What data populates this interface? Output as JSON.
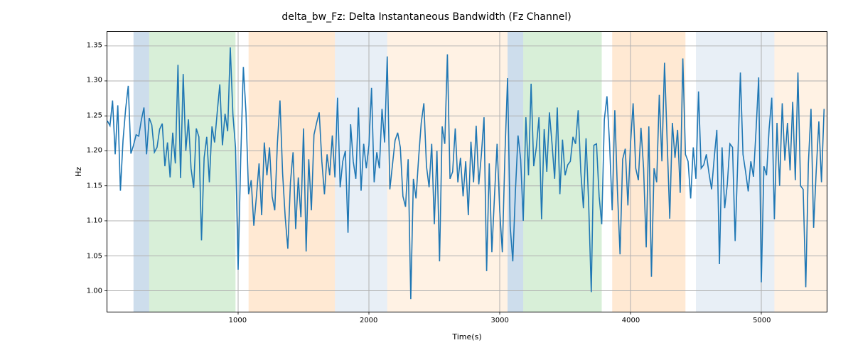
{
  "chart_data": {
    "type": "line",
    "title": "delta_bw_Fz: Delta Instantaneous Bandwidth (Fz Channel)",
    "xlabel": "Time(s)",
    "ylabel": "Hz",
    "xlim": [
      0,
      5500
    ],
    "ylim": [
      0.97,
      1.37
    ],
    "xticks": [
      1000,
      2000,
      3000,
      4000,
      5000
    ],
    "yticks": [
      1.0,
      1.05,
      1.1,
      1.15,
      1.2,
      1.25,
      1.3,
      1.35
    ],
    "grid": true,
    "regions": [
      {
        "x0": 200,
        "x1": 320,
        "class": "blue"
      },
      {
        "x0": 320,
        "x1": 980,
        "class": "green"
      },
      {
        "x0": 1080,
        "x1": 1740,
        "class": "orange"
      },
      {
        "x0": 1740,
        "x1": 2140,
        "class": "lblue"
      },
      {
        "x0": 2140,
        "x1": 3060,
        "class": "lorange"
      },
      {
        "x0": 3060,
        "x1": 3180,
        "class": "blue"
      },
      {
        "x0": 3180,
        "x1": 3780,
        "class": "green"
      },
      {
        "x0": 3860,
        "x1": 4420,
        "class": "orange"
      },
      {
        "x0": 4500,
        "x1": 5100,
        "class": "lblue"
      },
      {
        "x0": 5100,
        "x1": 5500,
        "class": "lorange"
      }
    ],
    "series": [
      {
        "name": "delta_bw_Fz",
        "color": "#1f77b4",
        "x_start": 0,
        "x_step": 20,
        "y": [
          1.243,
          1.236,
          1.272,
          1.195,
          1.265,
          1.143,
          1.215,
          1.26,
          1.293,
          1.196,
          1.208,
          1.223,
          1.221,
          1.244,
          1.262,
          1.195,
          1.247,
          1.237,
          1.198,
          1.205,
          1.231,
          1.239,
          1.178,
          1.212,
          1.162,
          1.226,
          1.182,
          1.323,
          1.161,
          1.31,
          1.2,
          1.245,
          1.175,
          1.147,
          1.232,
          1.22,
          1.072,
          1.19,
          1.22,
          1.155,
          1.235,
          1.212,
          1.255,
          1.295,
          1.208,
          1.253,
          1.228,
          1.348,
          1.252,
          1.205,
          1.03,
          1.19,
          1.32,
          1.255,
          1.138,
          1.158,
          1.093,
          1.135,
          1.182,
          1.108,
          1.212,
          1.165,
          1.205,
          1.135,
          1.115,
          1.21,
          1.272,
          1.168,
          1.105,
          1.06,
          1.155,
          1.198,
          1.088,
          1.162,
          1.105,
          1.232,
          1.056,
          1.188,
          1.115,
          1.223,
          1.24,
          1.255,
          1.185,
          1.138,
          1.195,
          1.165,
          1.222,
          1.162,
          1.276,
          1.148,
          1.185,
          1.2,
          1.083,
          1.238,
          1.185,
          1.16,
          1.262,
          1.143,
          1.21,
          1.175,
          1.208,
          1.29,
          1.155,
          1.198,
          1.175,
          1.26,
          1.212,
          1.335,
          1.145,
          1.18,
          1.215,
          1.226,
          1.205,
          1.135,
          1.12,
          1.188,
          0.988,
          1.16,
          1.132,
          1.19,
          1.24,
          1.268,
          1.178,
          1.148,
          1.21,
          1.095,
          1.2,
          1.042,
          1.235,
          1.21,
          1.338,
          1.16,
          1.17,
          1.232,
          1.155,
          1.19,
          1.135,
          1.185,
          1.108,
          1.213,
          1.155,
          1.236,
          1.152,
          1.195,
          1.248,
          1.028,
          1.182,
          1.055,
          1.135,
          1.21,
          1.115,
          1.055,
          1.195,
          1.304,
          1.092,
          1.042,
          1.142,
          1.222,
          1.188,
          1.1,
          1.248,
          1.165,
          1.296,
          1.178,
          1.205,
          1.248,
          1.102,
          1.231,
          1.17,
          1.255,
          1.21,
          1.16,
          1.262,
          1.138,
          1.216,
          1.165,
          1.18,
          1.185,
          1.22,
          1.21,
          1.258,
          1.17,
          1.118,
          1.218,
          1.125,
          0.998,
          1.208,
          1.21,
          1.135,
          1.095,
          1.245,
          1.278,
          1.21,
          1.115,
          1.258,
          1.143,
          1.052,
          1.188,
          1.203,
          1.122,
          1.21,
          1.268,
          1.175,
          1.158,
          1.233,
          1.175,
          1.062,
          1.235,
          1.02,
          1.175,
          1.155,
          1.28,
          1.185,
          1.326,
          1.215,
          1.103,
          1.24,
          1.19,
          1.23,
          1.14,
          1.332,
          1.195,
          1.185,
          1.132,
          1.205,
          1.16,
          1.285,
          1.175,
          1.18,
          1.195,
          1.168,
          1.145,
          1.19,
          1.23,
          1.038,
          1.205,
          1.118,
          1.152,
          1.21,
          1.205,
          1.071,
          1.185,
          1.312,
          1.195,
          1.17,
          1.142,
          1.185,
          1.163,
          1.23,
          1.305,
          1.012,
          1.178,
          1.165,
          1.232,
          1.276,
          1.102,
          1.24,
          1.15,
          1.268,
          1.186,
          1.24,
          1.172,
          1.27,
          1.158,
          1.312,
          1.15,
          1.145,
          1.005,
          1.182,
          1.26,
          1.09,
          1.172,
          1.242,
          1.155,
          1.26
        ]
      }
    ]
  },
  "xtick_labels": [
    "1000",
    "2000",
    "3000",
    "4000",
    "5000"
  ],
  "ytick_labels": [
    "1.00",
    "1.05",
    "1.10",
    "1.15",
    "1.20",
    "1.25",
    "1.30",
    "1.35"
  ]
}
